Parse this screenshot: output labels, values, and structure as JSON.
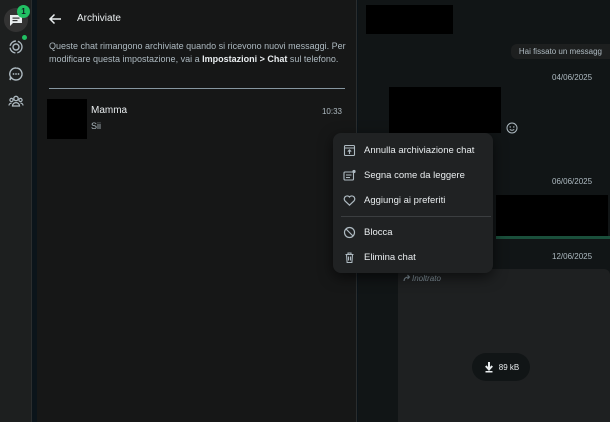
{
  "rail": {
    "chats_badge": "1"
  },
  "archived": {
    "title": "Archiviate",
    "info_prefix": "Queste chat rimangono archiviate quando si ricevono nuovi messaggi. Per modificare questa impostazione, vai a ",
    "info_bold": "Impostazioni > Chat",
    "info_suffix": " sul telefono.",
    "chats": [
      {
        "name": "Mamma",
        "time": "10:33",
        "preview": "Sii"
      }
    ]
  },
  "conversation": {
    "pinned_notice": "Hai fissato un messagg",
    "dates": [
      "04/06/2025",
      "06/06/2025",
      "12/06/2025"
    ],
    "forwarded_label": "Inoltrato",
    "file_size": "89 kB"
  },
  "context_menu": {
    "items": [
      {
        "label": "Annulla archiviazione chat",
        "icon": "unarchive-icon"
      },
      {
        "label": "Segna come da leggere",
        "icon": "mark-unread-icon"
      },
      {
        "label": "Aggiungi ai preferiti",
        "icon": "heart-icon"
      },
      {
        "label": "Blocca",
        "icon": "block-icon"
      },
      {
        "label": "Elimina chat",
        "icon": "trash-icon"
      }
    ]
  },
  "colors": {
    "accent": "#21c063",
    "panel_bg": "#161717",
    "menu_bg": "#202223"
  }
}
